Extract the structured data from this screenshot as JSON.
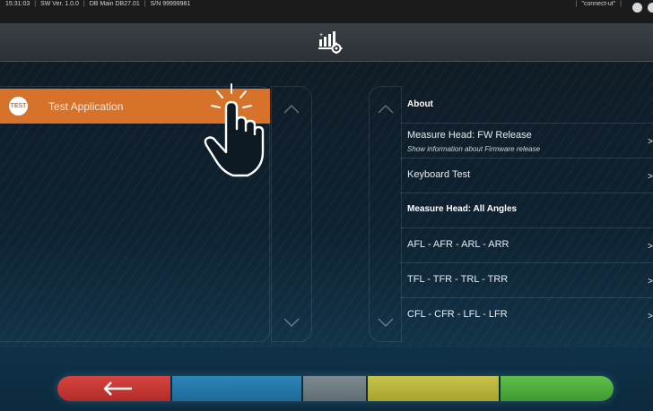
{
  "status_bar": {
    "time": "15:31:03",
    "sw_version": "SW Ver. 1.0.0",
    "db": "DB Main DB27.01",
    "serial": "S/N 99999981",
    "connection": "\"connect-ut\""
  },
  "header": {
    "icon": "tools-settings-icon"
  },
  "left_list": {
    "items": [
      {
        "badge": "TEST",
        "label": "Test Application",
        "selected": true
      }
    ],
    "pointer_icon": "hand-pointer-icon"
  },
  "right_list": {
    "items": [
      {
        "title": "About",
        "style": "header"
      },
      {
        "title": "Measure Head: FW Release",
        "subtitle": "Show information about Firmware release",
        "arrow": ">"
      },
      {
        "title": "Keyboard Test",
        "arrow": ">"
      },
      {
        "title": "Measure Head: All Angles",
        "style": "header"
      },
      {
        "title": "AFL - AFR - ARL - ARR",
        "arrow": ">"
      },
      {
        "title": "TFL - TFR - TRL - TRR",
        "arrow": ">"
      },
      {
        "title": "CFL - CFR - LFL - LFR",
        "arrow": ">"
      }
    ]
  },
  "bottom_bar": {
    "buttons": [
      {
        "name": "back",
        "color": "#c4342f",
        "icon": "back-arrow-icon"
      },
      {
        "name": "blue",
        "color": "#2478a8"
      },
      {
        "name": "gray",
        "color": "#6b787e"
      },
      {
        "name": "yellow",
        "color": "#b8b23a"
      },
      {
        "name": "green",
        "color": "#4cac3c"
      }
    ]
  },
  "colors": {
    "accent": "#d7722b"
  }
}
